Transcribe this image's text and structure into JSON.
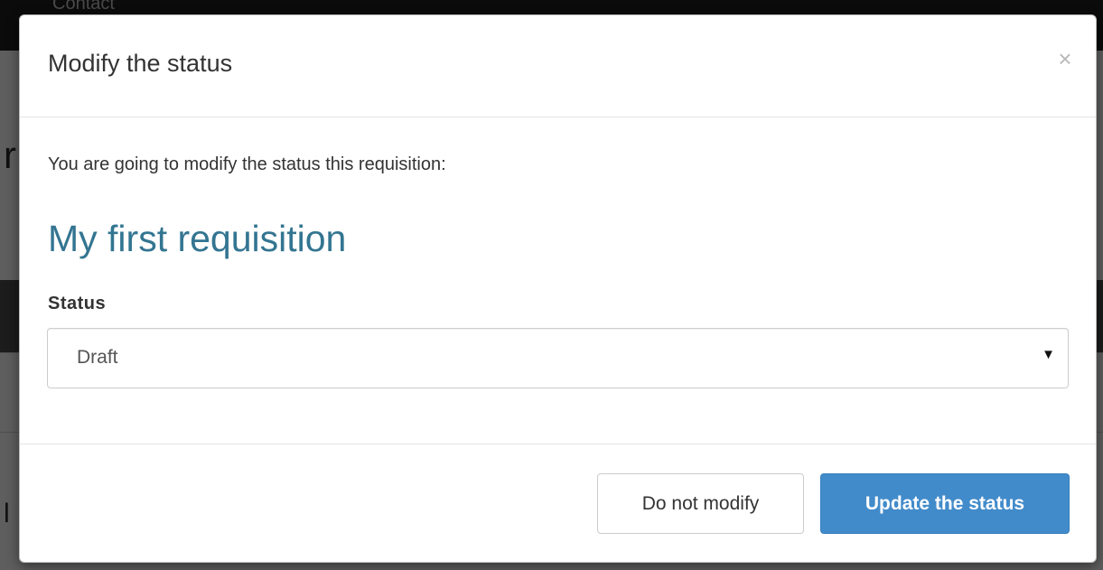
{
  "background": {
    "nav_link": "Contact"
  },
  "modal": {
    "title": "Modify the status",
    "close_label": "×",
    "intro": "You are going to modify the status this requisition:",
    "requisition_name": "My first requisition",
    "status_label": "Status",
    "status_value": "Draft",
    "status_arrow": "▼",
    "cancel_label": "Do not modify",
    "submit_label": "Update the status"
  },
  "colors": {
    "primary": "#428bca",
    "link": "#337591"
  }
}
